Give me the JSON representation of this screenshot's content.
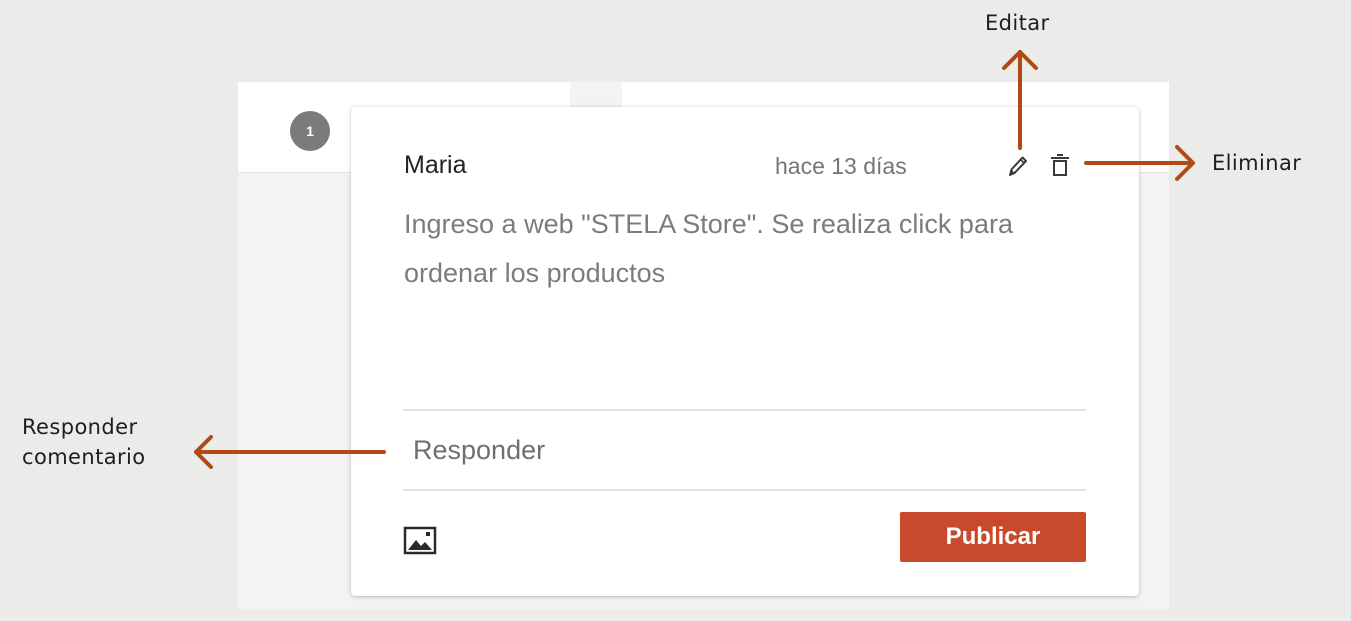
{
  "annotations": {
    "edit": "Editar",
    "delete": "Eliminar",
    "reply_line1": "Responder",
    "reply_line2": "comentario"
  },
  "thread": {
    "badge": "1"
  },
  "comment": {
    "author": "Maria",
    "timestamp": "hace 13 días",
    "text": "Ingreso a web \"STELA Store\". Se realiza click para ordenar los productos",
    "edit_icon": "pencil-icon",
    "delete_icon": "trash-icon"
  },
  "reply": {
    "placeholder": "Responder",
    "image_icon": "image-icon",
    "publish_label": "Publicar"
  },
  "colors": {
    "arrow": "#b04a14",
    "publish_button": "#c9492c",
    "background": "#ebebe9"
  }
}
